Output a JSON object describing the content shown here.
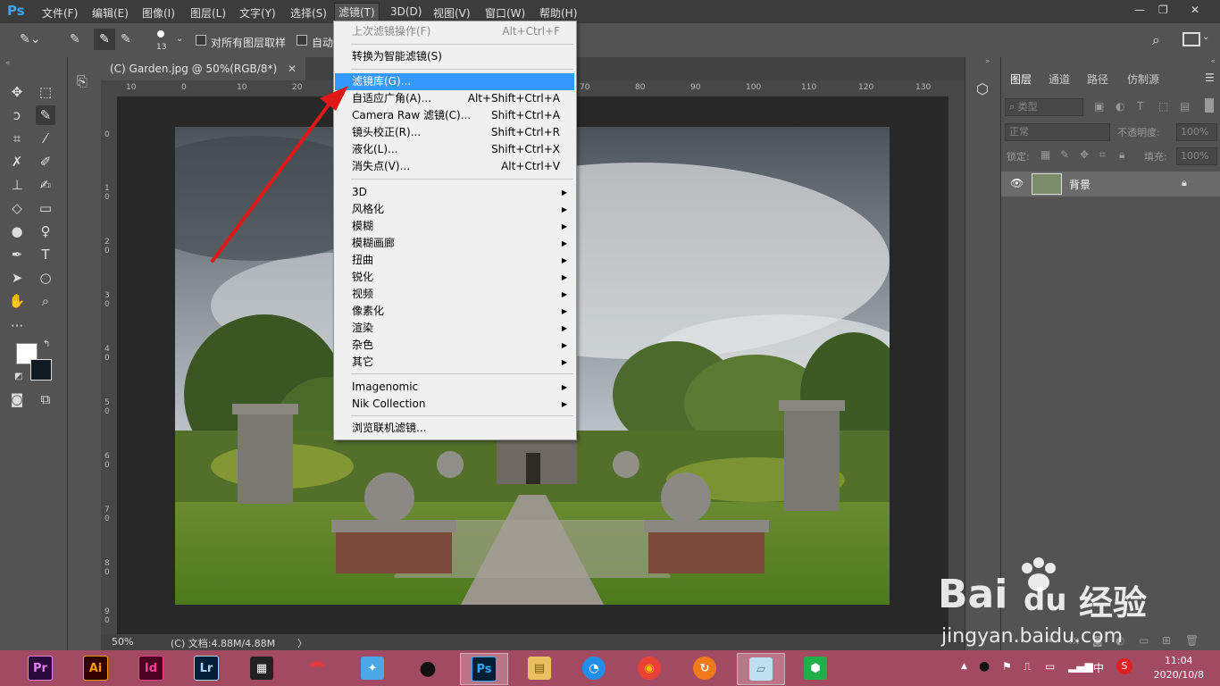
{
  "app": {
    "logo": "Ps"
  },
  "menubar": {
    "items": [
      "文件(F)",
      "编辑(E)",
      "图像(I)",
      "图层(L)",
      "文字(Y)",
      "选择(S)",
      "滤镜(T)",
      "3D(D)",
      "视图(V)",
      "窗口(W)",
      "帮助(H)"
    ],
    "active": "滤镜(T)"
  },
  "options": {
    "brush_size": "13",
    "sample_all_layers": "对所有图层取样",
    "auto_enhance": "自动"
  },
  "document": {
    "tab_title": "(C) Garden.jpg @ 50%(RGB/8*)",
    "ruler_top": [
      "10",
      "0",
      "10",
      "20",
      "30",
      "40",
      "50",
      "60",
      "70",
      "80",
      "90",
      "100",
      "110",
      "120",
      "130",
      "140"
    ],
    "ruler_left": [
      "0",
      "1\n0",
      "2\n0",
      "3\n0",
      "4\n0",
      "5\n0",
      "6\n0",
      "7\n0",
      "8\n0",
      "9\n0"
    ],
    "zoom": "50%",
    "doc_info": "(C) 文档:4.88M/4.88M"
  },
  "filter_menu": {
    "items": [
      {
        "label": "上次滤镜操作(F)",
        "shortcut": "Alt+Ctrl+F",
        "disabled": true
      },
      {
        "sep": true
      },
      {
        "label": "转换为智能滤镜(S)"
      },
      {
        "sep": true
      },
      {
        "label": "滤镜库(G)...",
        "highlighted": true
      },
      {
        "label": "自适应广角(A)...",
        "shortcut": "Alt+Shift+Ctrl+A"
      },
      {
        "label": "Camera Raw 滤镜(C)...",
        "shortcut": "Shift+Ctrl+A"
      },
      {
        "label": "镜头校正(R)...",
        "shortcut": "Shift+Ctrl+R"
      },
      {
        "label": "液化(L)...",
        "shortcut": "Shift+Ctrl+X"
      },
      {
        "label": "消失点(V)...",
        "shortcut": "Alt+Ctrl+V"
      },
      {
        "sep": true
      },
      {
        "label": "3D",
        "submenu": true
      },
      {
        "label": "风格化",
        "submenu": true
      },
      {
        "label": "模糊",
        "submenu": true
      },
      {
        "label": "模糊画廊",
        "submenu": true
      },
      {
        "label": "扭曲",
        "submenu": true
      },
      {
        "label": "锐化",
        "submenu": true
      },
      {
        "label": "视频",
        "submenu": true
      },
      {
        "label": "像素化",
        "submenu": true
      },
      {
        "label": "渲染",
        "submenu": true
      },
      {
        "label": "杂色",
        "submenu": true
      },
      {
        "label": "其它",
        "submenu": true
      },
      {
        "sep": true
      },
      {
        "label": "Imagenomic",
        "submenu": true
      },
      {
        "label": "Nik Collection",
        "submenu": true
      },
      {
        "sep": true
      },
      {
        "label": "浏览联机滤镜..."
      }
    ]
  },
  "layers_panel": {
    "tabs": [
      "图层",
      "通道",
      "路径",
      "仿制源"
    ],
    "active_tab": "图层",
    "filter_kind": "类型",
    "blend_mode": "正常",
    "opacity_label": "不透明度:",
    "opacity_value": "100%",
    "lock_label": "锁定:",
    "fill_label": "填充:",
    "fill_value": "100%",
    "layer_name": "背景"
  },
  "taskbar": {
    "apps": [
      {
        "label": "Pr",
        "bg": "#2a0a3a",
        "fg": "#e77cf5"
      },
      {
        "label": "Ai",
        "bg": "#330000",
        "fg": "#ff9a00"
      },
      {
        "label": "Id",
        "bg": "#49021f",
        "fg": "#ff3f94"
      },
      {
        "label": "Lr",
        "bg": "#001e36",
        "fg": "#a6d4ff"
      }
    ],
    "ime": "中",
    "time": "11:04",
    "date": "2020/10/8"
  },
  "watermark": {
    "brand": "Bai",
    "brand2": "du",
    "suffix": "经验",
    "url": "jingyan.baidu.com"
  }
}
